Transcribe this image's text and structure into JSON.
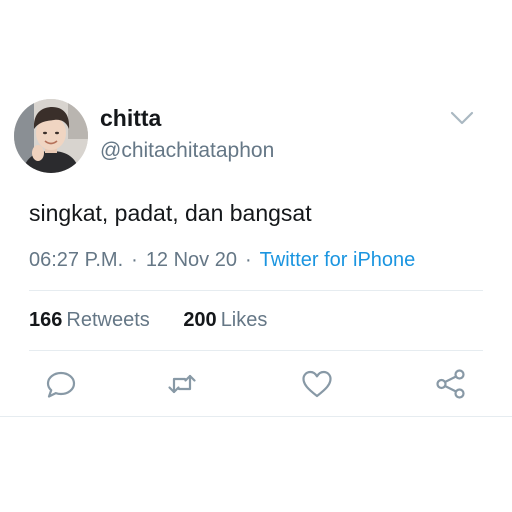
{
  "user": {
    "display_name": "chitta",
    "handle": "@chitachitataphon"
  },
  "tweet": {
    "text": "singkat, padat, dan bangsat",
    "time": "06:27 P.M.",
    "date": "12 Nov 20",
    "separator": "·",
    "source": "Twitter for iPhone"
  },
  "stats": {
    "retweets_count": "166",
    "retweets_label": "Retweets",
    "likes_count": "200",
    "likes_label": "Likes"
  },
  "icons": {
    "menu": "chevron-down-icon",
    "reply": "reply-icon",
    "retweet": "retweet-icon",
    "like": "heart-icon",
    "share": "share-icon"
  },
  "colors": {
    "text": "#14171a",
    "muted": "#657786",
    "link": "#1b95e0",
    "divider": "#e6ecf0",
    "icon": "#8899a6"
  }
}
